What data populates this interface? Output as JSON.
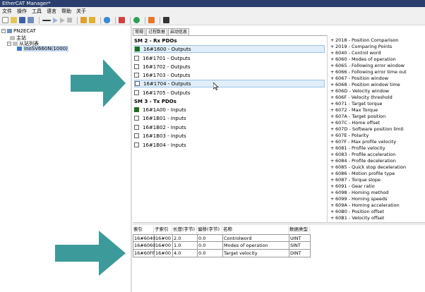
{
  "window": {
    "title": "EtherCAT Manager*"
  },
  "menu": [
    "文件",
    "操作",
    "工具",
    "语言",
    "帮助",
    "关于"
  ],
  "tree": {
    "root": "PN2ECAT",
    "master": "主站",
    "slave_list": "从站列表",
    "slave": "InoSV660N(1000)"
  },
  "tabs": [
    "常规",
    "过程数据",
    "启动信息"
  ],
  "sm2": {
    "heading": "SM 2 - Rx PDOs",
    "items": [
      {
        "label": "16#1600  -  Outputs",
        "checked": true
      },
      {
        "label": "16#1701  -  Outputs",
        "checked": false
      },
      {
        "label": "16#1702  -  Outputs",
        "checked": false
      },
      {
        "label": "16#1703  -  Outputs",
        "checked": false
      },
      {
        "label": "16#1704  -  Outputs",
        "checked": false
      },
      {
        "label": "16#1705  -  Outputs",
        "checked": false
      }
    ]
  },
  "sm3": {
    "heading": "SM 3 - Tx PDOs",
    "items": [
      {
        "label": "16#1A00  -  Inputs",
        "checked": true
      },
      {
        "label": "16#1B01  -  Inputs",
        "checked": false
      },
      {
        "label": "16#1B02  -  Inputs",
        "checked": false
      },
      {
        "label": "16#1B03  -  Inputs",
        "checked": false
      },
      {
        "label": "16#1B04  -  Inputs",
        "checked": false
      }
    ]
  },
  "objects": [
    "2018 - Position Comparison",
    "2019 - Comparing Points",
    "6040 - Control word",
    "6060 - Modes of operation",
    "6065 - Following error window",
    "6066 - Following error time out",
    "6067 - Position window",
    "6068 - Position window time",
    "606D - Velocity window",
    "606F - Velocity threshold",
    "6071 - Target torque",
    "6072 - Max Torque",
    "607A - Target position",
    "607C - Home offset",
    "607D - Software position limit",
    "607E - Polarity",
    "607F - Max profile velocity",
    "6081 - Profile velocity",
    "6083 - Profile acceleration",
    "6084 - Profile deceleration",
    "6085 - Quick stop deceleration",
    "6086 - Motion profile type",
    "6087 - Torque slope",
    "6091 - Gear ratio",
    "6098 - Homing method",
    "6099 - Homing speeds",
    "609A - Homing acceleration",
    "60B0 - Position offset",
    "60B1 - Velocity offset"
  ],
  "grid": {
    "headers": [
      "索引",
      "子索引",
      "长度(字节)",
      "偏移(字节)",
      "名称",
      "数据类型"
    ],
    "rows": [
      [
        "16#6040",
        "16#00",
        "2.0",
        "0.0",
        "Controlword",
        "UINT"
      ],
      [
        "16#6060",
        "16#00",
        "1.0",
        "0.0",
        "Modes of operation",
        "SINT"
      ],
      [
        "16#60FF",
        "16#00",
        "4.0",
        "0.0",
        "Target velocity",
        "DINT"
      ]
    ]
  },
  "colors": {
    "arrow": "#3d9a9a",
    "title_bar": "#2a3f6e",
    "check": "#1f6f1f"
  }
}
